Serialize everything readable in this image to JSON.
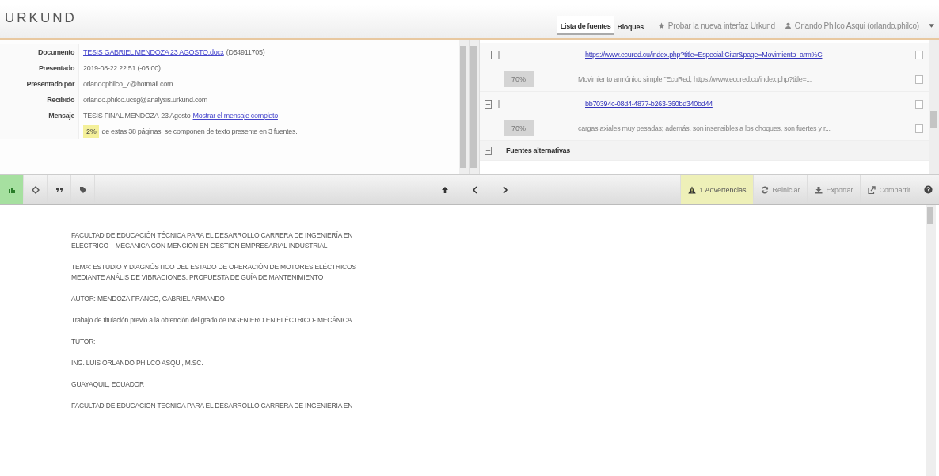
{
  "header": {
    "logo": "URKUND",
    "tabs": [
      {
        "label": "Lista de fuentes",
        "selected": true
      },
      {
        "label": "Bloques",
        "selected": false
      }
    ],
    "try_link": "Probar la nueva interfaz Urkund",
    "user": "Orlando Philco Asqui (orlando.philco)"
  },
  "info": {
    "rows": [
      {
        "label": "Documento",
        "link": "TESIS GABRIEL MENDOZA 23 AGOSTO.docx",
        "value": "(D54911705)"
      },
      {
        "label": "Presentado",
        "value": "2019-08-22 22:51 (-05:00)"
      },
      {
        "label": "Presentado por",
        "value": "orlandophilco_7@hotmail.com"
      },
      {
        "label": "Recibido",
        "value": "orlando.philco.ucsg@analysis.urkund.com"
      },
      {
        "label": "Mensaje",
        "value": "TESIS FINAL MENDOZA-23 Agosto",
        "link_after": "Mostrar el mensaje completo"
      }
    ],
    "summary": {
      "percent": "2%",
      "text": "de estas 38 páginas, se componen de texto presente en 3 fuentes."
    }
  },
  "sources": [
    {
      "kind": "source",
      "expanded": true,
      "url": "https://www.ecured.cu/index.php?title=Especial:Citar&page=Movimiento_arm%C",
      "checked": false
    },
    {
      "kind": "match",
      "percent": "70%",
      "text": "Movimiento armónico simple,\"EcuRed, https://www.ecured.cu/index.php?title=...",
      "checked": false
    },
    {
      "kind": "source",
      "expanded": true,
      "url": "bb70394c-08d4-4877-b263-360bd340bd44",
      "checked": false
    },
    {
      "kind": "match",
      "percent": "70%",
      "text": "cargas axiales muy pesadas; además, son insensibles a los choques, son fuertes y r...",
      "checked": false
    },
    {
      "kind": "group",
      "expanded": true,
      "label": "Fuentes alternativas"
    }
  ],
  "toolbar": {
    "left": [
      {
        "kind": "chart",
        "selected": true
      },
      {
        "kind": "diamond",
        "selected": false
      },
      {
        "kind": "quote",
        "selected": false
      },
      {
        "kind": "tag",
        "selected": false
      }
    ],
    "buttons": [
      {
        "kind": "warning",
        "label": "1 Advertencias",
        "highlighted": true
      },
      {
        "kind": "refresh",
        "label": "Reiniciar",
        "highlighted": false
      },
      {
        "kind": "export",
        "label": "Exportar",
        "highlighted": false
      },
      {
        "kind": "share",
        "label": "Compartir",
        "highlighted": false
      }
    ]
  },
  "document": {
    "paragraphs": [
      "FACULTAD DE EDUCACIÓN TÉCNICA PARA EL DESARROLLO CARRERA DE INGENIERÍA EN\nELÉCTRICO – MECÁNICA CON MENCIÓN EN GESTIÓN EMPRESARIAL INDUSTRIAL",
      "TEMA: ESTUDIO Y DIAGNÓSTICO DEL ESTADO DE OPERACIÓN DE MOTORES ELÉCTRICOS\nMEDIANTE ANÁLIS DE VIBRACIONES. PROPUESTA DE GUÍA DE MANTENIMIENTO",
      "AUTOR: MENDOZA FRANCO, GABRIEL ARMANDO",
      "Trabajo de titulación previo a la obtención del grado de INGENIERO EN ELÉCTRICO- MECÁNICA",
      "TUTOR:",
      "ING. LUIS ORLANDO PHILCO ASQUI, M.SC.",
      "GUAYAQUIL, ECUADOR",
      "FACULTAD DE EDUCACIÓN TÉCNICA PARA EL DESARROLLO CARRERA DE INGENIERÍA EN"
    ]
  }
}
